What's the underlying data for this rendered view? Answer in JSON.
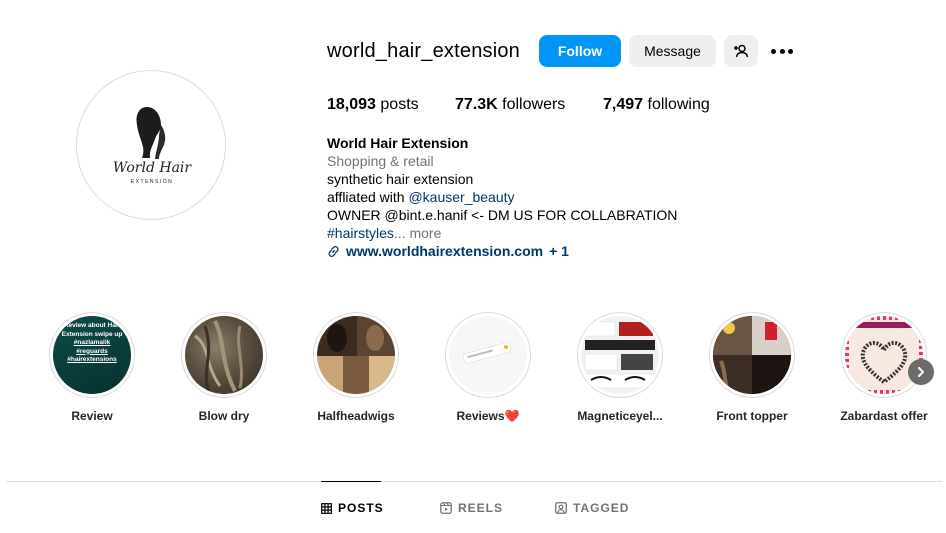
{
  "profile": {
    "username": "world_hair_extension",
    "follow_label": "Follow",
    "message_label": "Message",
    "avatar_text": "World Hair",
    "avatar_subtext": "EXTENSION"
  },
  "stats": {
    "posts_count": "18,093",
    "posts_label": "posts",
    "followers_count": "77.3K",
    "followers_label": "followers",
    "following_count": "7,497",
    "following_label": "following"
  },
  "bio": {
    "name": "World Hair Extension",
    "category": "Shopping & retail",
    "line1": "synthetic hair extension",
    "line2_prefix": "affliated with ",
    "line2_mention": "@kauser_beauty",
    "line3": "OWNER @bint.e.hanif <- DM US FOR COLLABRATION",
    "line4_hashtag": "#hairstyles",
    "line4_more": "... more",
    "link_text": "www.worldhairextension.com",
    "link_extra": " + 1"
  },
  "highlights": [
    {
      "label": "Review",
      "thumb_text": [
        "Review about Hair",
        "Extension swipe up",
        "#nazlamalik",
        "#reguards",
        "#hairextensions"
      ]
    },
    {
      "label": "Blow dry"
    },
    {
      "label": "Halfheadwigs"
    },
    {
      "label": "Reviews❤️"
    },
    {
      "label": "Magneticeyel..."
    },
    {
      "label": "Front topper"
    },
    {
      "label": "Zabardast offer"
    }
  ],
  "tabs": [
    {
      "label": "POSTS",
      "icon": "grid-icon",
      "active": true
    },
    {
      "label": "REELS",
      "icon": "reels-icon",
      "active": false
    },
    {
      "label": "TAGGED",
      "icon": "tagged-icon",
      "active": false
    }
  ],
  "colors": {
    "follow_button": "#0095f6",
    "secondary_button": "#efefef",
    "link": "#00376b",
    "muted": "#737373"
  }
}
